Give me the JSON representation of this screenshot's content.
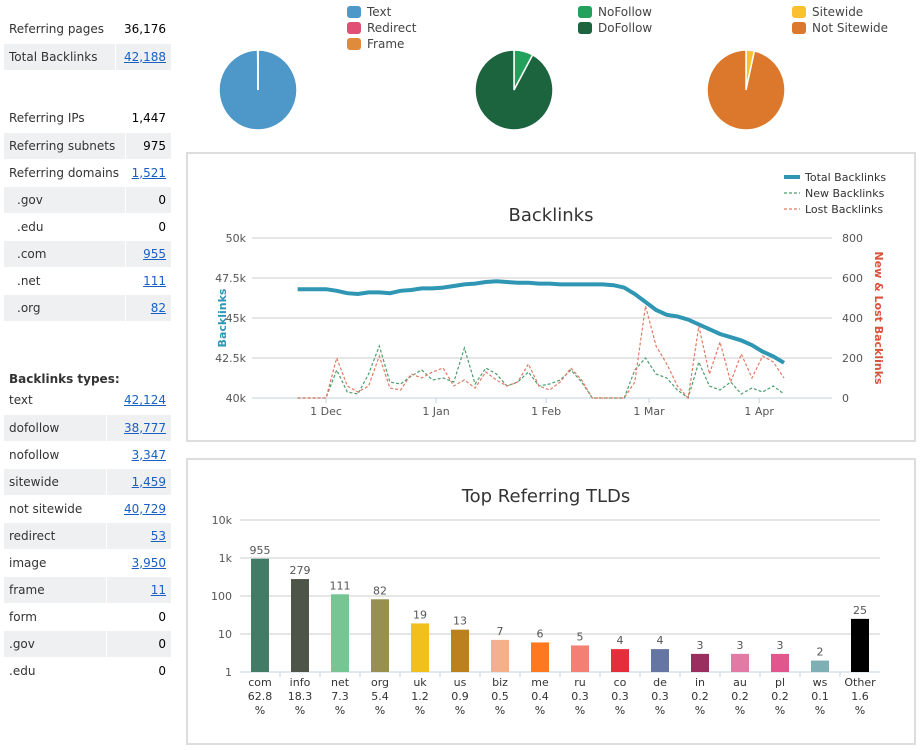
{
  "summary1": [
    {
      "label": "Referring pages",
      "value": "36,176",
      "link": false
    },
    {
      "label": "Total Backlinks",
      "value": "42,188",
      "link": true
    }
  ],
  "summary2": [
    {
      "label": "Referring IPs",
      "value": "1,447",
      "link": false
    },
    {
      "label": "Referring subnets",
      "value": "975",
      "link": false
    },
    {
      "label": "Referring domains",
      "value": "1,521",
      "link": true
    },
    {
      "label": ".gov",
      "value": "0",
      "link": false,
      "indent": true
    },
    {
      "label": ".edu",
      "value": "0",
      "link": false,
      "indent": true
    },
    {
      "label": ".com",
      "value": "955",
      "link": true,
      "indent": true
    },
    {
      "label": ".net",
      "value": "111",
      "link": true,
      "indent": true
    },
    {
      "label": ".org",
      "value": "82",
      "link": true,
      "indent": true
    }
  ],
  "types_header": "Backlinks types:",
  "types": [
    {
      "label": "text",
      "value": "42,124",
      "link": true
    },
    {
      "label": "dofollow",
      "value": "38,777",
      "link": true
    },
    {
      "label": "nofollow",
      "value": "3,347",
      "link": true
    },
    {
      "label": "sitewide",
      "value": "1,459",
      "link": true
    },
    {
      "label": "not sitewide",
      "value": "40,729",
      "link": true
    },
    {
      "label": "redirect",
      "value": "53",
      "link": true
    },
    {
      "label": "image",
      "value": "3,950",
      "link": true
    },
    {
      "label": "frame",
      "value": "11",
      "link": true
    },
    {
      "label": "form",
      "value": "0",
      "link": false
    },
    {
      "label": ".gov",
      "value": "0",
      "link": false
    },
    {
      "label": ".edu",
      "value": "0",
      "link": false
    }
  ],
  "chart_data": [
    {
      "type": "pie",
      "legend": [
        {
          "name": "Text",
          "color": "#4e97c9"
        },
        {
          "name": "Redirect",
          "color": "#e05075"
        },
        {
          "name": "Frame",
          "color": "#e08a3c"
        }
      ],
      "values": [
        42124,
        53,
        11
      ]
    },
    {
      "type": "pie",
      "legend": [
        {
          "name": "NoFollow",
          "color": "#22a05c"
        },
        {
          "name": "DoFollow",
          "color": "#1b643e"
        }
      ],
      "values": [
        3347,
        38777
      ]
    },
    {
      "type": "pie",
      "legend": [
        {
          "name": "Sitewide",
          "color": "#fbc02d"
        },
        {
          "name": "Not Sitewide",
          "color": "#dc782c"
        }
      ],
      "values": [
        1459,
        40729
      ]
    },
    {
      "type": "line",
      "title": "Backlinks",
      "ylabel": "Backlinks",
      "y2label": "New & Lost Backlinks",
      "ylim": [
        40000,
        50000
      ],
      "yticks": [
        "40k",
        "42.5k",
        "45k",
        "47.5k",
        "50k"
      ],
      "y2lim": [
        0,
        800
      ],
      "y2ticks": [
        "0",
        "200",
        "400",
        "600",
        "800"
      ],
      "xticks": [
        "1 Dec",
        "1 Jan",
        "1 Feb",
        "1 Mar",
        "1 Apr"
      ],
      "legend_position": "top-right",
      "x": [
        "2015-11-23",
        "2015-11-27",
        "2015-12-01",
        "2015-12-04",
        "2015-12-07",
        "2015-12-10",
        "2015-12-13",
        "2015-12-16",
        "2015-12-19",
        "2015-12-22",
        "2015-12-25",
        "2015-12-28",
        "2015-12-31",
        "2016-01-03",
        "2016-01-06",
        "2016-01-09",
        "2016-01-12",
        "2016-01-15",
        "2016-01-18",
        "2016-01-21",
        "2016-01-24",
        "2016-01-27",
        "2016-01-30",
        "2016-02-02",
        "2016-02-05",
        "2016-02-08",
        "2016-02-11",
        "2016-02-14",
        "2016-02-17",
        "2016-02-20",
        "2016-02-23",
        "2016-02-26",
        "2016-02-29",
        "2016-03-03",
        "2016-03-06",
        "2016-03-09",
        "2016-03-12",
        "2016-03-15",
        "2016-03-18",
        "2016-03-21",
        "2016-03-24",
        "2016-03-27",
        "2016-03-30",
        "2016-04-02",
        "2016-04-05",
        "2016-04-08"
      ],
      "series": [
        {
          "name": "Total Backlinks",
          "color": "#2f96b4",
          "axis": "left",
          "values": [
            46800,
            46800,
            46800,
            46700,
            46550,
            46500,
            46600,
            46600,
            46550,
            46700,
            46750,
            46850,
            46850,
            46900,
            47000,
            47100,
            47150,
            47250,
            47300,
            47250,
            47200,
            47200,
            47150,
            47150,
            47100,
            47100,
            47100,
            47100,
            47100,
            47050,
            46900,
            46500,
            46000,
            45500,
            45200,
            45100,
            44900,
            44600,
            44300,
            44000,
            43800,
            43600,
            43300,
            42900,
            42600,
            42200
          ]
        },
        {
          "name": "New Backlinks",
          "color": "#4a9e6e",
          "axis": "right",
          "dashed": true,
          "values": [
            0,
            0,
            0,
            140,
            30,
            20,
            120,
            260,
            80,
            70,
            110,
            140,
            90,
            100,
            80,
            250,
            70,
            150,
            120,
            60,
            80,
            130,
            60,
            70,
            90,
            140,
            80,
            0,
            0,
            0,
            0,
            140,
            200,
            120,
            100,
            40,
            0,
            180,
            60,
            40,
            80,
            20,
            50,
            30,
            60,
            20
          ]
        },
        {
          "name": "Lost Backlinks",
          "color": "#e37a64",
          "axis": "right",
          "dashed": true,
          "values": [
            0,
            0,
            0,
            200,
            60,
            30,
            60,
            210,
            50,
            40,
            120,
            100,
            130,
            150,
            60,
            90,
            50,
            130,
            90,
            60,
            80,
            170,
            60,
            40,
            80,
            150,
            90,
            0,
            0,
            0,
            0,
            80,
            460,
            260,
            170,
            60,
            0,
            360,
            120,
            280,
            80,
            220,
            100,
            210,
            180,
            100
          ]
        }
      ]
    },
    {
      "type": "bar",
      "title": "Top Referring TLDs",
      "yscale": "log",
      "ylim": [
        1,
        10000
      ],
      "yticks": [
        "1",
        "10",
        "100",
        "1k",
        "10k"
      ],
      "categories": [
        "com",
        "info",
        "net",
        "org",
        "uk",
        "us",
        "biz",
        "me",
        "ru",
        "co",
        "de",
        "in",
        "au",
        "pl",
        "ws",
        "Other"
      ],
      "values": [
        955,
        279,
        111,
        82,
        19,
        13,
        7,
        6,
        5,
        4,
        4,
        3,
        3,
        3,
        2,
        25
      ],
      "percents": [
        "62.8",
        "18.3",
        "7.3",
        "5.4",
        "1.2",
        "0.9",
        "0.5",
        "0.4",
        "0.3",
        "0.3",
        "0.3",
        "0.2",
        "0.2",
        "0.2",
        "0.1",
        "1.6"
      ],
      "percent_sign": "%",
      "colors": [
        "#427c66",
        "#4f5449",
        "#76c593",
        "#979051",
        "#f2c01d",
        "#bb811f",
        "#f4b08c",
        "#fd781f",
        "#f47f74",
        "#e52e3b",
        "#6676a2",
        "#9a2e5f",
        "#e27aa6",
        "#e1578d",
        "#7eafb4",
        "#000000"
      ]
    }
  ]
}
